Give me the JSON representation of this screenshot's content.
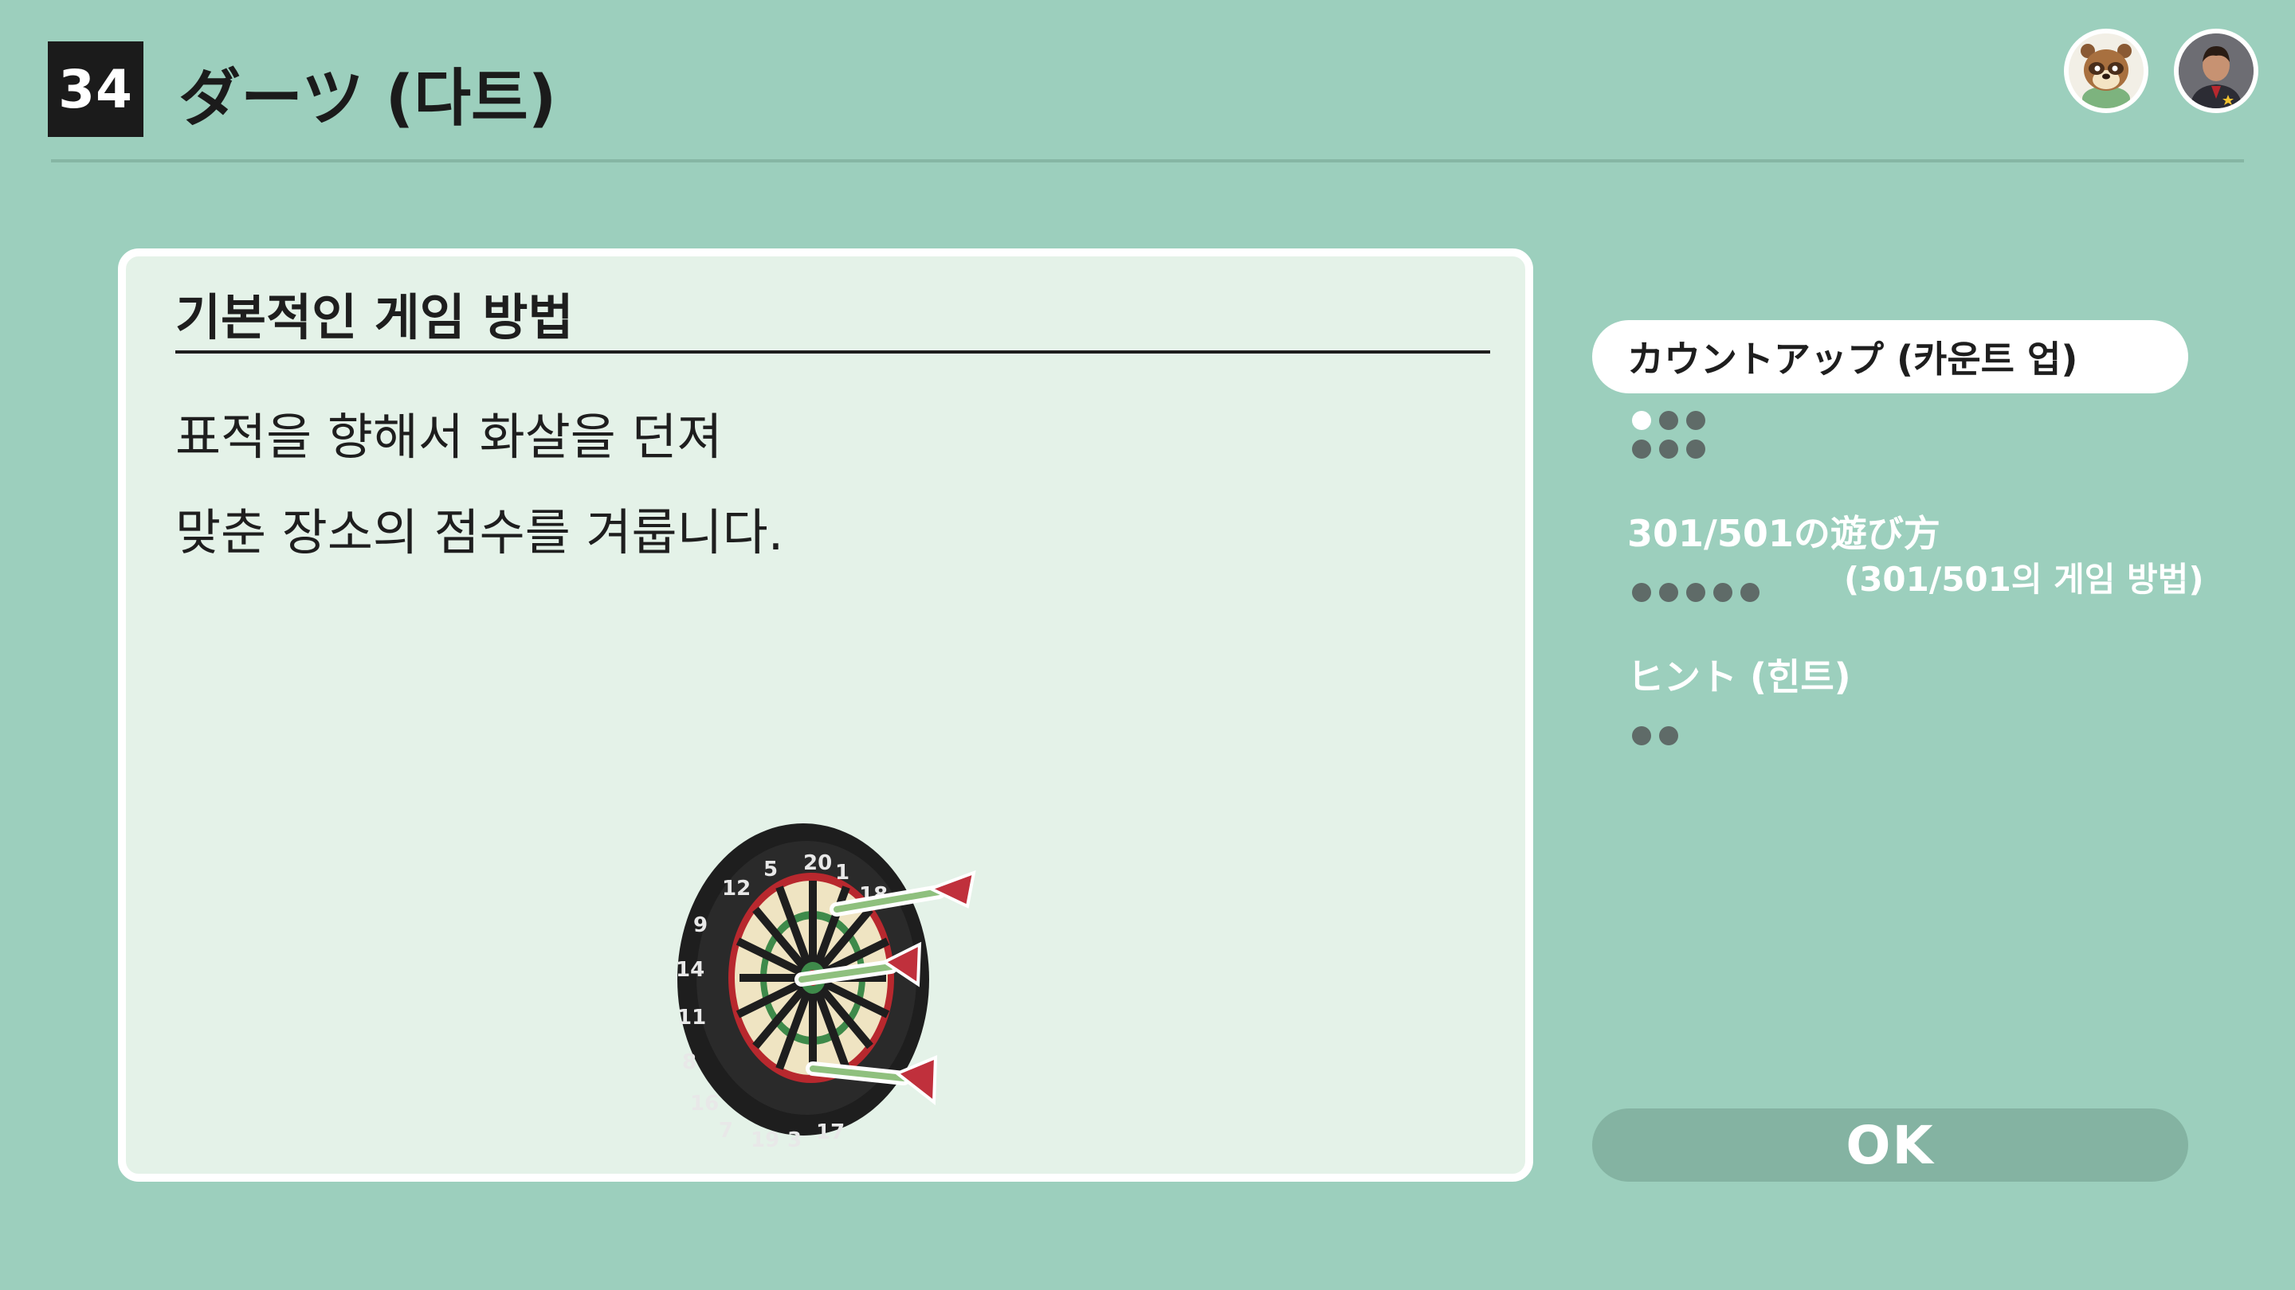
{
  "header": {
    "number": "34",
    "title": "ダーツ (다트)"
  },
  "avatars": [
    {
      "icon": "raccoon-character-icon"
    },
    {
      "icon": "user-profile-icon"
    }
  ],
  "panel": {
    "heading": "기본적인 게임 방법",
    "lines": [
      "표적을 향해서 화살을 던져",
      "맞춘 장소의 점수를 겨룹니다."
    ],
    "illustration": "dartboard-with-darts"
  },
  "menu": {
    "items": [
      {
        "label": "カウントアップ (카운트 업)",
        "selected": true,
        "pages": 6,
        "current_page": 1
      },
      {
        "label": "301/501の遊び方",
        "sublabel": "(301/501의 게임 방법)",
        "selected": false,
        "pages": 5,
        "current_page": 0
      },
      {
        "label": "ヒント (힌트)",
        "selected": false,
        "pages": 2,
        "current_page": 0
      }
    ],
    "ok_label": "OK"
  },
  "colors": {
    "background": "#9ccfbd",
    "panel": "#e4f2e8",
    "selected_item": "#ffffff",
    "ok_button": "#84b3a2",
    "dot_active": "#ffffff",
    "dot_inactive": "#5f6b68"
  }
}
